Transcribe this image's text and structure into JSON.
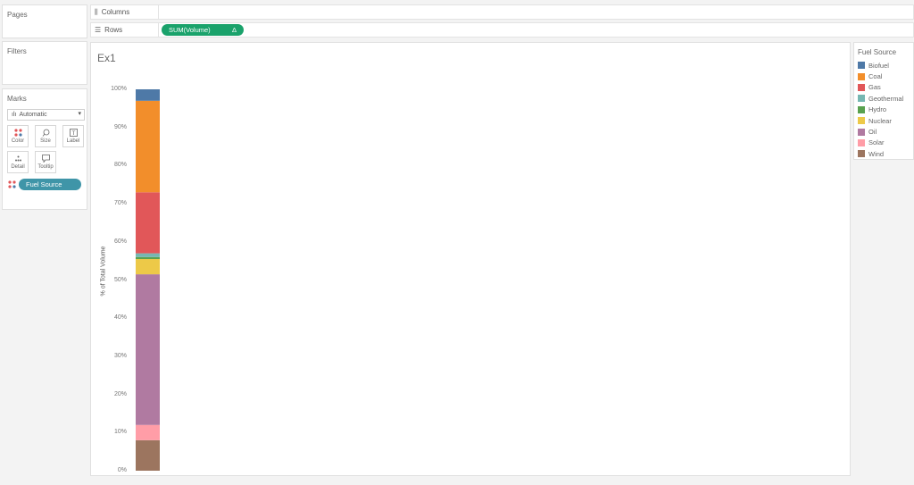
{
  "panes": {
    "pages_title": "Pages",
    "filters_title": "Filters",
    "marks_title": "Marks"
  },
  "shelves": {
    "columns_label": "Columns",
    "rows_label": "Rows",
    "rows_pill": "SUM(Volume)",
    "rows_pill_delta": "Δ"
  },
  "marks": {
    "mark_type": "Automatic",
    "buttons": [
      "Color",
      "Size",
      "Label",
      "Detail",
      "Tooltip"
    ],
    "color_pill": "Fuel Source"
  },
  "sheet": {
    "title": "Ex1"
  },
  "legend": {
    "title": "Fuel Source",
    "items": [
      {
        "label": "Biofuel",
        "color": "#4e79a7"
      },
      {
        "label": "Coal",
        "color": "#f28e2b"
      },
      {
        "label": "Gas",
        "color": "#e15759"
      },
      {
        "label": "Geothermal",
        "color": "#76b7b2"
      },
      {
        "label": "Hydro",
        "color": "#59a14f"
      },
      {
        "label": "Nuclear",
        "color": "#edc948"
      },
      {
        "label": "Oil",
        "color": "#b07aa1"
      },
      {
        "label": "Solar",
        "color": "#ff9da7"
      },
      {
        "label": "Wind",
        "color": "#9c755f"
      }
    ]
  },
  "chart_data": {
    "type": "bar",
    "stacked": true,
    "title": "",
    "xlabel": "",
    "ylabel": "% of Total Volume",
    "ylim": [
      0,
      100
    ],
    "yticks": [
      "0%",
      "10%",
      "20%",
      "30%",
      "40%",
      "50%",
      "60%",
      "70%",
      "80%",
      "90%",
      "100%"
    ],
    "series": [
      {
        "name": "Wind",
        "values": [
          8
        ],
        "color": "#9c755f"
      },
      {
        "name": "Solar",
        "values": [
          4
        ],
        "color": "#ff9da7"
      },
      {
        "name": "Oil",
        "values": [
          39.5
        ],
        "color": "#b07aa1"
      },
      {
        "name": "Nuclear",
        "values": [
          4
        ],
        "color": "#edc948"
      },
      {
        "name": "Hydro",
        "values": [
          0.5
        ],
        "color": "#59a14f"
      },
      {
        "name": "Geothermal",
        "values": [
          1
        ],
        "color": "#76b7b2"
      },
      {
        "name": "Gas",
        "values": [
          16
        ],
        "color": "#e15759"
      },
      {
        "name": "Coal",
        "values": [
          24
        ],
        "color": "#f28e2b"
      },
      {
        "name": "Biofuel",
        "values": [
          3
        ],
        "color": "#4e79a7"
      }
    ]
  }
}
